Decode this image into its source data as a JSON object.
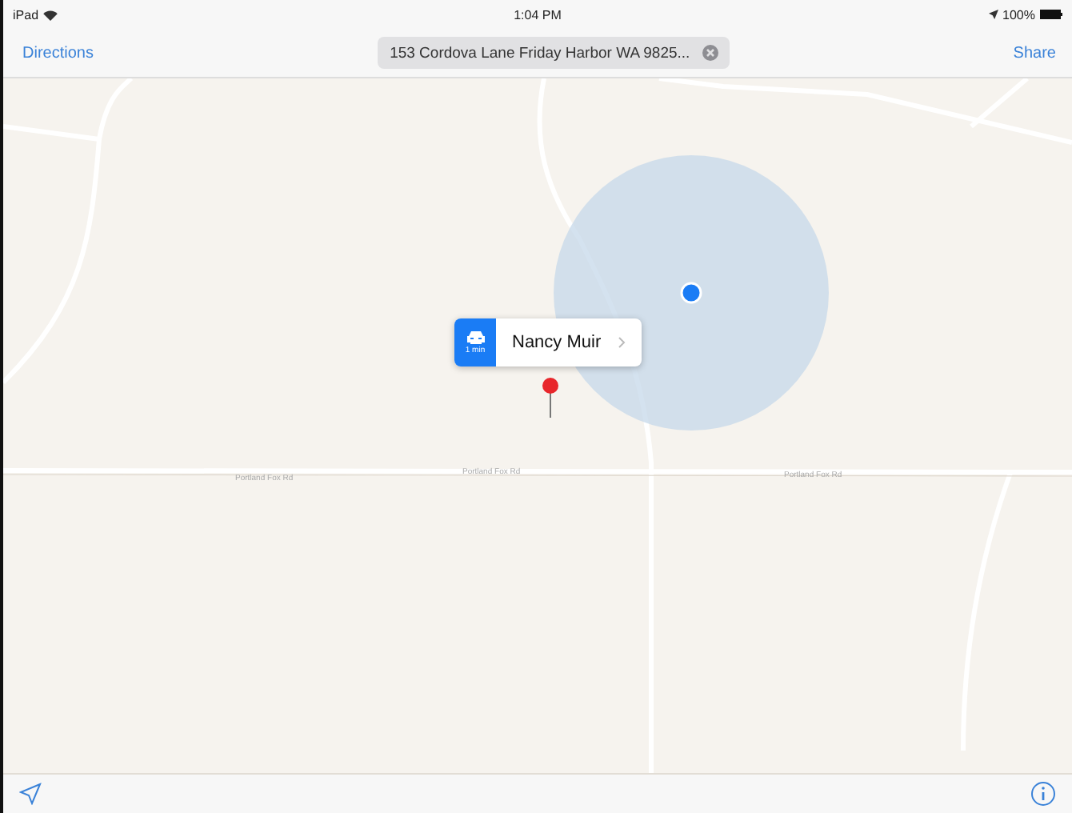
{
  "status_bar": {
    "device": "iPad",
    "time": "1:04 PM",
    "battery": "100%"
  },
  "nav_bar": {
    "left_button": "Directions",
    "search": {
      "value": "153  Cordova Lane Friday Harbor WA 9825..."
    },
    "right_button": "Share"
  },
  "map": {
    "road_labels": [
      {
        "text": "Portland Fox Rd"
      },
      {
        "text": "Portland Fox Rd"
      },
      {
        "text": "Portland Fox Rd"
      }
    ],
    "callout": {
      "eta": "1 min",
      "title": "Nancy Muir"
    }
  }
}
